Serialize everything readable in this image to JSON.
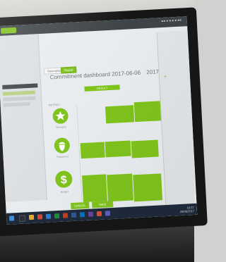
{
  "tabs": [
    {
      "label": "Description"
    },
    {
      "label": "Report"
    }
  ],
  "report_title": "Commitment dashboard 2017-06-06",
  "report_date": "2017-06-06",
  "column_header": "RESULT",
  "metrics_label": "METRICS",
  "rows": [
    {
      "icon": "star-icon",
      "label": "Strengths"
    },
    {
      "icon": "acorn-icon",
      "label": "Resources"
    },
    {
      "icon": "dollar-icon",
      "label": "Budget"
    }
  ],
  "buttons": {
    "cancel": "CANCEL",
    "save": "SAVE"
  },
  "taskbar": {
    "time": "16:37",
    "date": "26/06/2017"
  },
  "colors": {
    "accent": "#7fc31c",
    "topbar": "#3e4447",
    "taskbar": "#1e2a3a"
  }
}
